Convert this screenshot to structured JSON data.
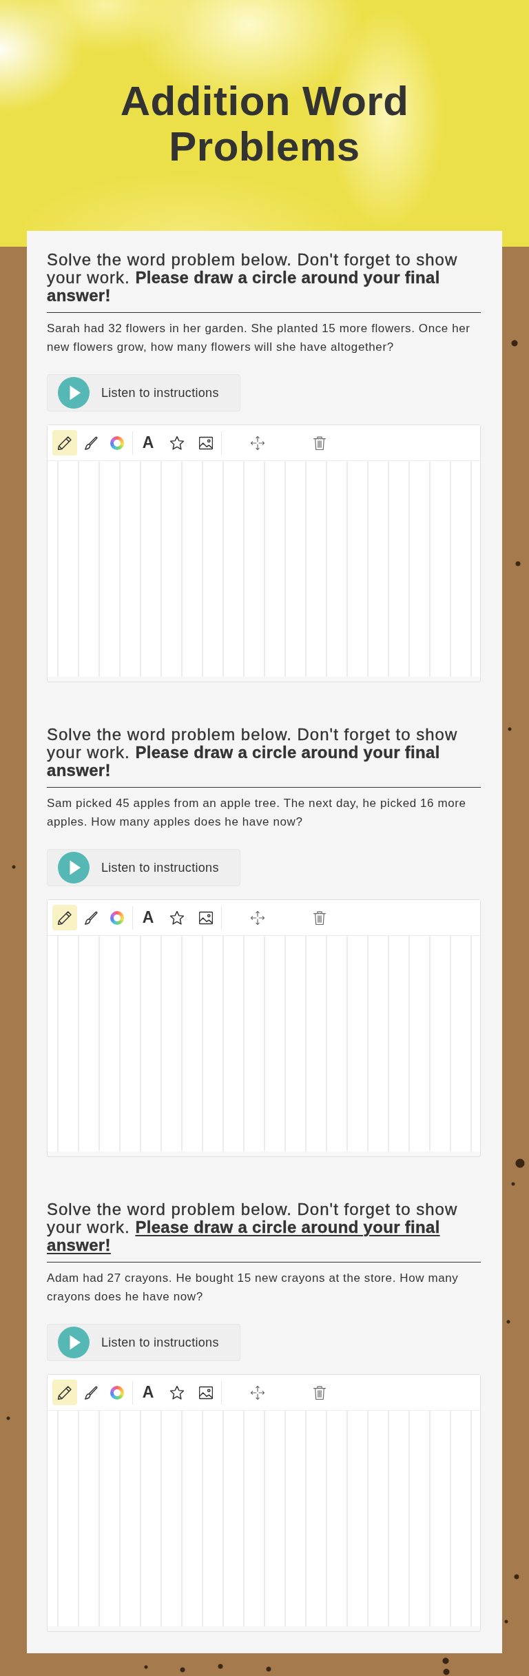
{
  "page_title": "Addition Word Problems",
  "questions": [
    {
      "heading": "Solve the word problem below. Don't forget to show your work. **Please draw a circle around your final answer!**",
      "bold_part_underlined": false,
      "problem": "Sarah had 32 flowers in her garden. She planted 15 more flowers. Once her new flowers grow, how many flowers will she have altogether?",
      "listen_label": "Listen to instructions",
      "tool_groups": [
        [
          {
            "kind": "pencil",
            "selected": true
          },
          {
            "kind": "brush",
            "selected": false
          },
          {
            "kind": "color",
            "selected": false
          }
        ],
        [
          {
            "kind": "text",
            "label": "A",
            "selected": false
          },
          {
            "kind": "star",
            "selected": false
          },
          {
            "kind": "image",
            "selected": false
          }
        ],
        [
          {
            "kind": "move",
            "selected": false
          },
          {
            "kind": "trash",
            "selected": false
          }
        ]
      ]
    },
    {
      "heading": "Solve the word problem below. Don't forget to show your work. **Please draw a circle around your final answer!**",
      "bold_part_underlined": false,
      "problem": "Sam picked 45 apples from an apple tree. The next day, he picked 16 more apples. How many apples does he have now?",
      "listen_label": "Listen to instructions",
      "tool_groups": [
        [
          {
            "kind": "pencil",
            "selected": true
          },
          {
            "kind": "brush",
            "selected": false
          },
          {
            "kind": "color",
            "selected": false
          }
        ],
        [
          {
            "kind": "text",
            "label": "A",
            "selected": false
          },
          {
            "kind": "star",
            "selected": false
          },
          {
            "kind": "image",
            "selected": false
          }
        ],
        [
          {
            "kind": "move",
            "selected": false
          },
          {
            "kind": "trash",
            "selected": false
          }
        ]
      ]
    },
    {
      "heading": "Solve the word problem below. Don't forget to show your work. **Please draw a circle around your final answer!**",
      "bold_part_underlined": true,
      "problem": "Adam had 27 crayons. He bought 15 new crayons at the store. How many crayons does he have now?",
      "listen_label": "Listen to instructions",
      "tool_groups": [
        [
          {
            "kind": "pencil",
            "selected": true
          },
          {
            "kind": "brush",
            "selected": false
          },
          {
            "kind": "color",
            "selected": false
          }
        ],
        [
          {
            "kind": "text",
            "label": "A",
            "selected": false
          },
          {
            "kind": "star",
            "selected": false
          },
          {
            "kind": "image",
            "selected": false
          }
        ],
        [
          {
            "kind": "move",
            "selected": false
          },
          {
            "kind": "trash",
            "selected": false
          }
        ]
      ]
    }
  ]
}
